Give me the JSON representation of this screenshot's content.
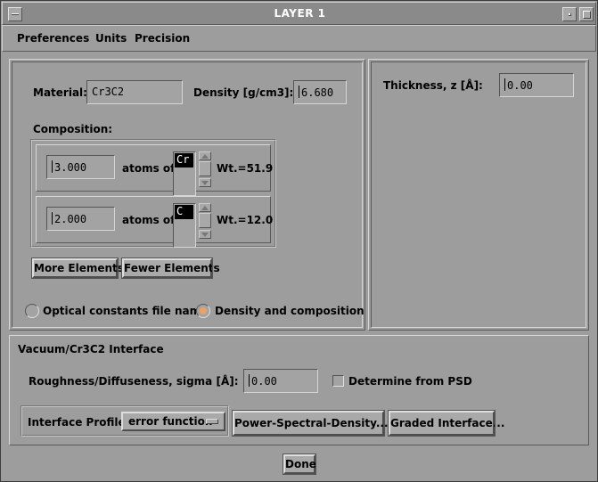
{
  "window": {
    "title": "LAYER 1"
  },
  "menubar": {
    "items": [
      "Preferences",
      "Units",
      "Precision"
    ]
  },
  "material": {
    "label": "Material:",
    "value": "Cr3C2",
    "density_label": "Density [g/cm3]:",
    "density_value": "6.680"
  },
  "composition": {
    "label": "Composition:",
    "rows": [
      {
        "atoms": "3.000",
        "atoms_of_label": "atoms of",
        "element": "Cr",
        "weight": "Wt.=51.9"
      },
      {
        "atoms": "2.000",
        "atoms_of_label": "atoms of",
        "element": "C",
        "weight": "Wt.=12.0"
      }
    ],
    "more_button": "More Elements",
    "fewer_button": "Fewer Elements"
  },
  "mode": {
    "options": [
      "Optical constants file name",
      "Density and composition"
    ],
    "selected": "Density and composition",
    "selected_color": "#f0a060"
  },
  "thickness": {
    "label": "Thickness, z [Å]:",
    "value": "0.00"
  },
  "interface": {
    "title": "Vacuum/Cr3C2 Interface",
    "roughness_label": "Roughness/Diffuseness, sigma [Å]:",
    "roughness_value": "0.00",
    "determine_psd_label": "Determine from PSD",
    "determine_psd_checked": false,
    "profile_label": "Interface Profile:",
    "profile_value": "error function",
    "psd_button": "Power-Spectral-Density...",
    "graded_button": "Graded Interface..."
  },
  "footer": {
    "done_button": "Done"
  }
}
